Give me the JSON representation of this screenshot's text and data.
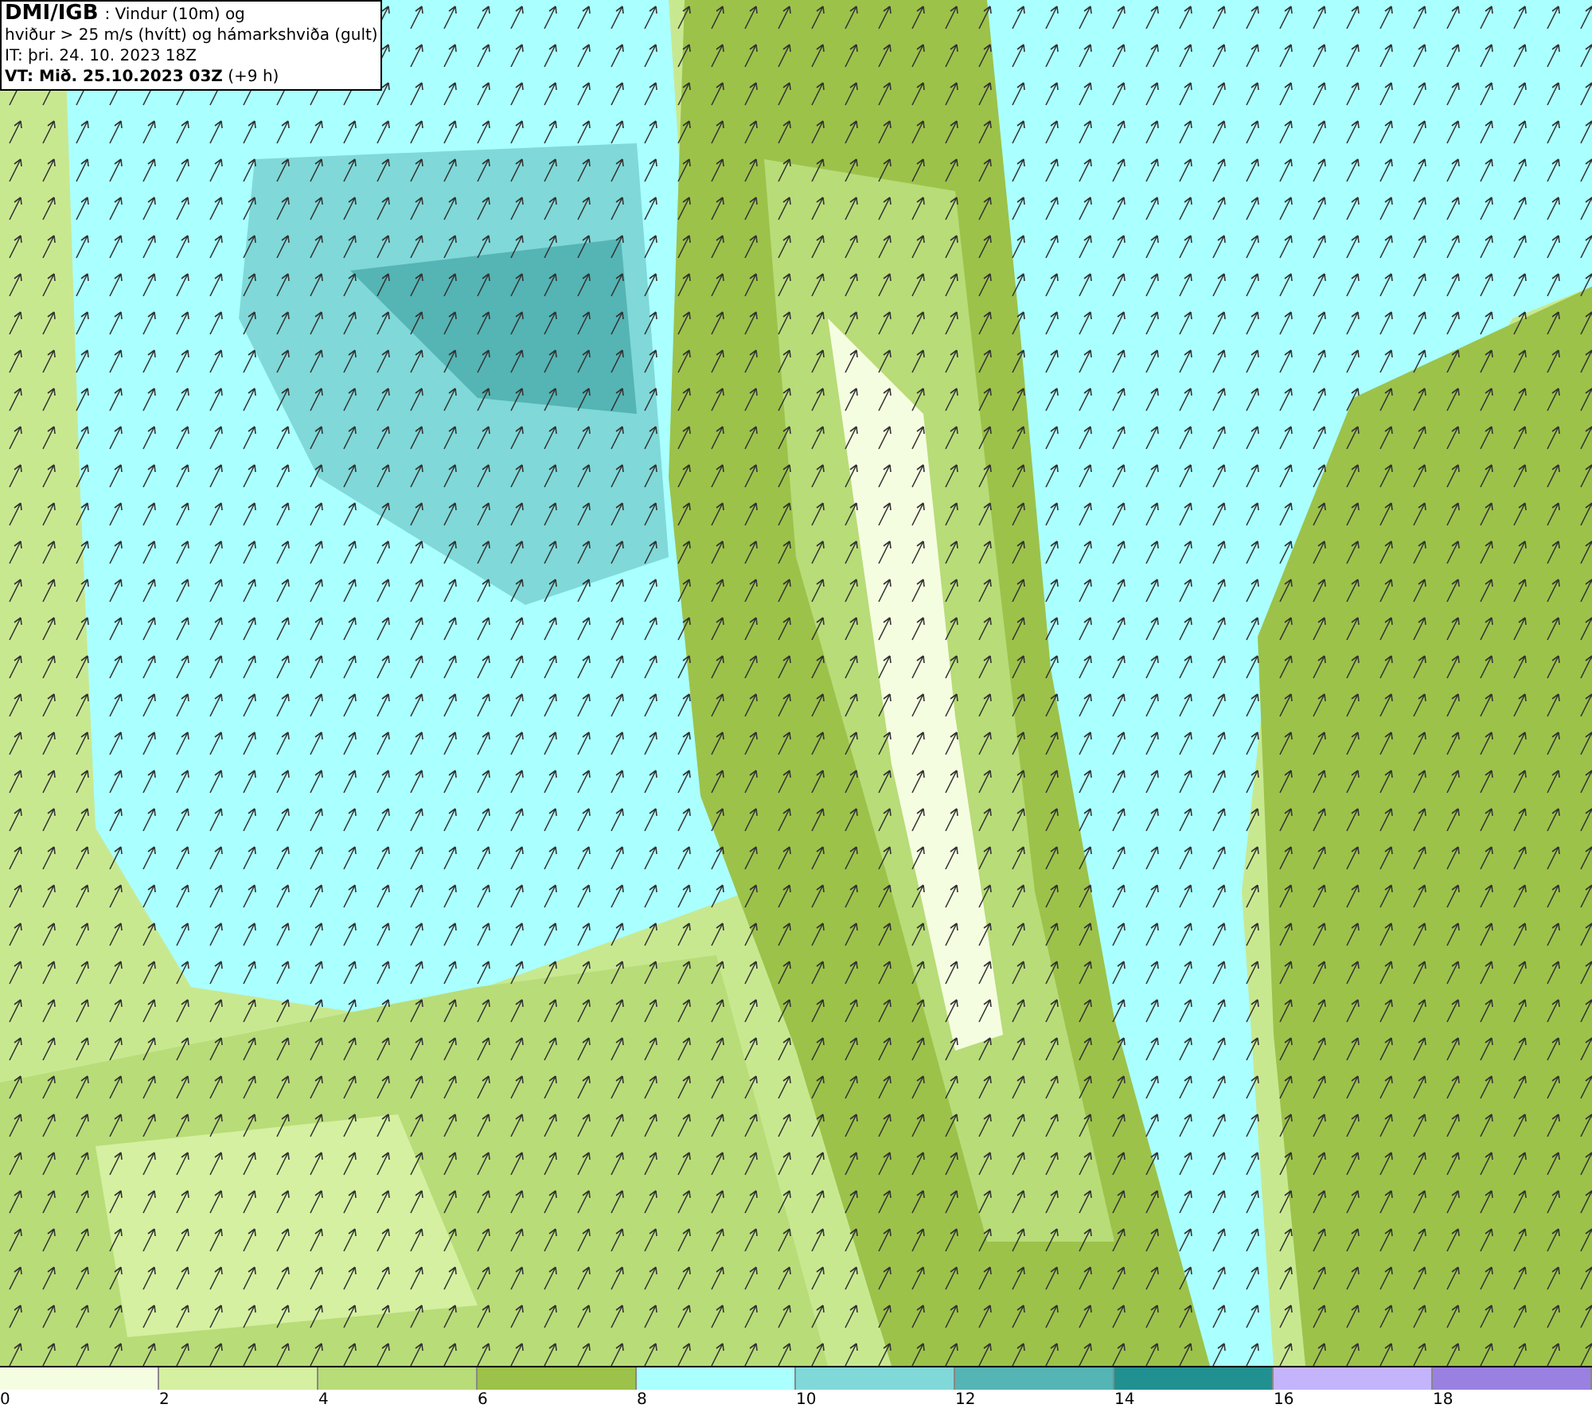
{
  "header": {
    "source": "DMI/IGB",
    "title_rest": ": Vindur (10m) og",
    "lines": [
      "hviður > 25 m/s (hvítt) og hámarkshviða (gult)",
      "IT: þri. 24. 10. 2023 18Z",
      "**VT: Mið. 25.10.2023 03Z** (+9 h)"
    ]
  },
  "legend": [
    {
      "label": "0",
      "color": "#f5fde0"
    },
    {
      "label": "2",
      "color": "#d4f0a0"
    },
    {
      "label": "4",
      "color": "#b8dc78"
    },
    {
      "label": "6",
      "color": "#9cc24a"
    },
    {
      "label": "8",
      "color": "#aaffff"
    },
    {
      "label": "10",
      "color": "#80d8d8"
    },
    {
      "label": "12",
      "color": "#55b4b4"
    },
    {
      "label": "14",
      "color": "#219090"
    },
    {
      "label": "16",
      "color": "#c4b4fc"
    },
    {
      "label": "18",
      "color": "#9a80e0"
    }
  ]
}
